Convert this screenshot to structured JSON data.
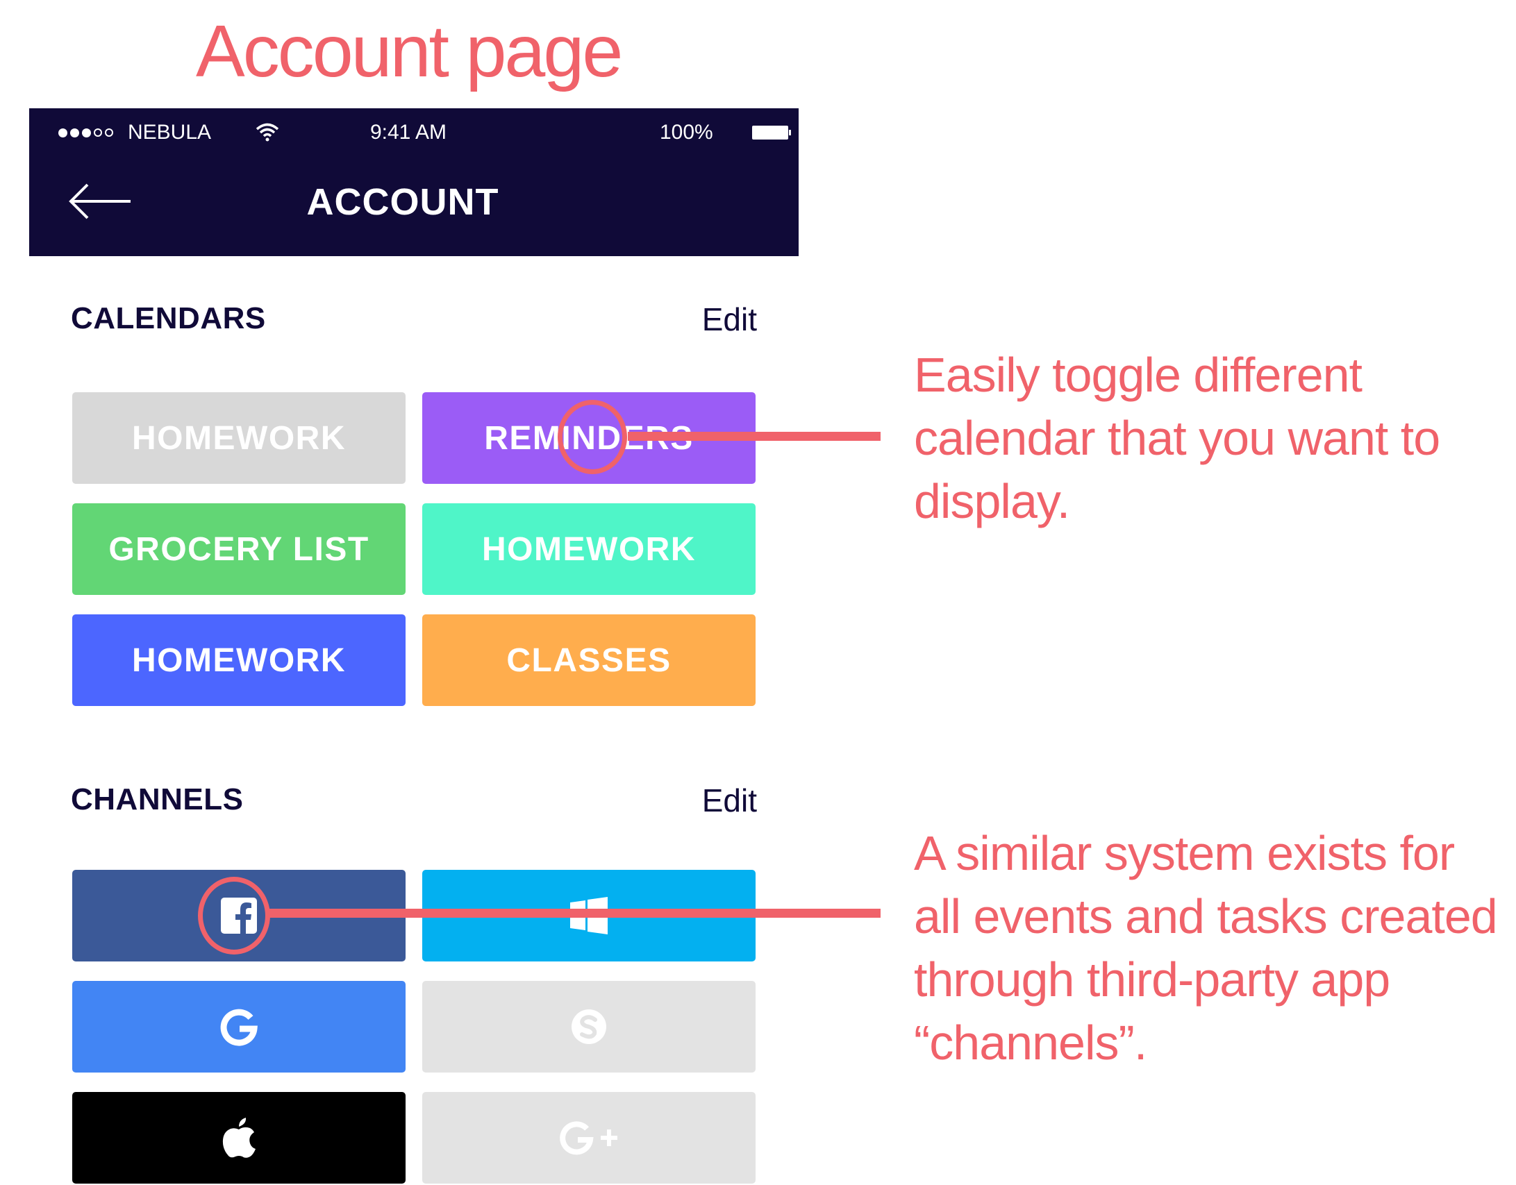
{
  "slide": {
    "title": "Account page"
  },
  "status_bar": {
    "carrier": "NEBULA",
    "time": "9:41 AM",
    "battery": "100%"
  },
  "nav": {
    "title": "ACCOUNT",
    "back_icon": "back-arrow-icon"
  },
  "calendars": {
    "title": "CALENDARS",
    "edit_label": "Edit",
    "items": [
      {
        "label": "HOMEWORK",
        "color": "#d8d8d8",
        "enabled": false
      },
      {
        "label": "REMINDERS",
        "color": "#9b5cf6",
        "enabled": true
      },
      {
        "label": "GROCERY LIST",
        "color": "#62d675",
        "enabled": true
      },
      {
        "label": "HOMEWORK",
        "color": "#4ff5c8",
        "enabled": true
      },
      {
        "label": "HOMEWORK",
        "color": "#4c66ff",
        "enabled": true
      },
      {
        "label": "CLASSES",
        "color": "#ffad4d",
        "enabled": true
      }
    ]
  },
  "channels": {
    "title": "CHANNELS",
    "edit_label": "Edit",
    "items": [
      {
        "icon": "facebook-icon",
        "color": "#3b5998",
        "enabled": true
      },
      {
        "icon": "windows-icon",
        "color": "#03b0f0",
        "enabled": true
      },
      {
        "icon": "google-icon",
        "color": "#4285f4",
        "enabled": true
      },
      {
        "icon": "skype-icon",
        "color": "#e3e3e3",
        "enabled": false
      },
      {
        "icon": "apple-icon",
        "color": "#000000",
        "enabled": true
      },
      {
        "icon": "google-plus-icon",
        "color": "#e3e3e3",
        "enabled": false
      }
    ]
  },
  "annotations": [
    {
      "text": "Easily toggle different calendar that you want to display."
    },
    {
      "text": "A similar system exists for all events and tasks created through third-party app “channels”."
    }
  ],
  "colors": {
    "accent": "#f0626a",
    "navbar": "#100a38"
  }
}
